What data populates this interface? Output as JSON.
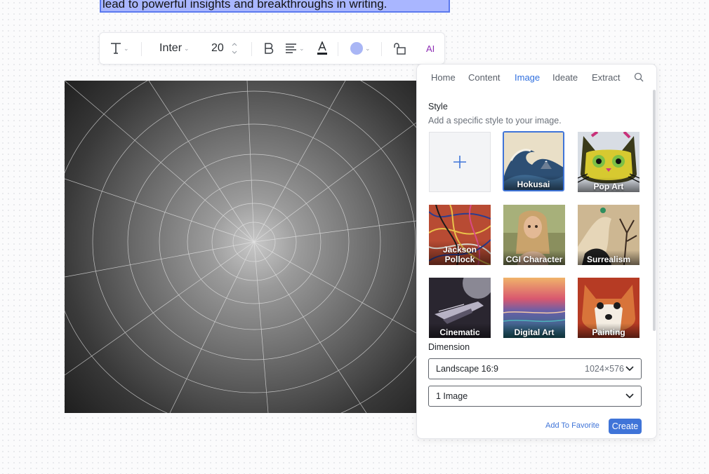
{
  "selected_text": "lead to powerful insights and breakthroughs in writing.",
  "toolbar": {
    "font_name": "Inter",
    "font_size": "20",
    "ai_label": "AI",
    "fill_color": "#a9b6f5",
    "text_color": "#1f2328"
  },
  "panel": {
    "tabs": [
      {
        "label": "Home"
      },
      {
        "label": "Content"
      },
      {
        "label": "Image"
      },
      {
        "label": "Ideate"
      },
      {
        "label": "Extract"
      }
    ],
    "active_tab": "Image",
    "style": {
      "title": "Style",
      "subtitle": "Add a specific style to your image.",
      "options": [
        {
          "label": "Hokusai"
        },
        {
          "label": "Pop Art"
        },
        {
          "label": "Jackson Pollock"
        },
        {
          "label": "CGI Character"
        },
        {
          "label": "Surrealism"
        },
        {
          "label": "Cinematic"
        },
        {
          "label": "Digital Art"
        },
        {
          "label": "Painting"
        }
      ],
      "selected": "Hokusai"
    },
    "dimension": {
      "title": "Dimension",
      "orientation": "Landscape 16:9",
      "size": "1024×576",
      "count": "1 Image"
    },
    "add_favorite": "Add To Favorite",
    "create": "Create"
  },
  "colors": {
    "accent": "#3f74d8",
    "selection": "#a9b6ff"
  }
}
